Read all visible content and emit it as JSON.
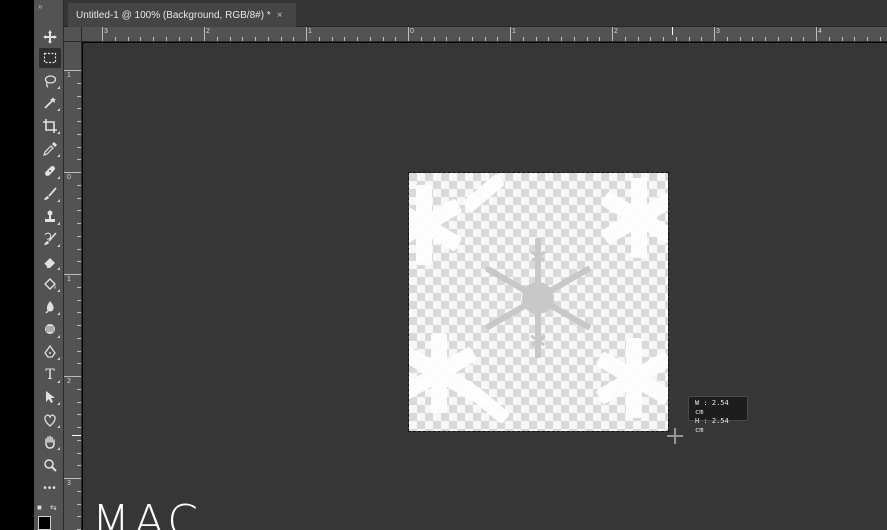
{
  "document_tab": {
    "title": "Untitled-1 @ 100% (Background, RGB/8#) *",
    "close_icon": "×"
  },
  "ruler_horizontal": {
    "labels": [
      "3",
      "2",
      "1",
      "0",
      "1",
      "2",
      "3",
      "4"
    ]
  },
  "ruler_vertical": {
    "labels": [
      "1",
      "0",
      "1",
      "2",
      "3"
    ]
  },
  "size_tooltip": {
    "width_line": "W :  2.54 cm",
    "height_line": "H :  2.54 cm"
  },
  "watermark": {
    "text": "MAC"
  },
  "toolbar": {
    "grip": "»",
    "more": "•••",
    "text_tool_glyph": "T",
    "tools": [
      "move-tool",
      "rectangular-marquee-tool",
      "lasso-tool",
      "quick-selection-tool",
      "crop-tool",
      "eyedropper-tool",
      "healing-brush-tool",
      "brush-tool",
      "clone-stamp-tool",
      "history-brush-tool",
      "eraser-tool",
      "paint-bucket-tool",
      "blur-tool",
      "dodge-tool",
      "pen-tool",
      "type-tool",
      "path-selection-tool",
      "custom-shape-tool",
      "hand-tool",
      "zoom-tool",
      "more-tools"
    ]
  },
  "colors": {
    "workspace": "#363636",
    "toolbar": "#535353",
    "selection": "#ffffff"
  }
}
